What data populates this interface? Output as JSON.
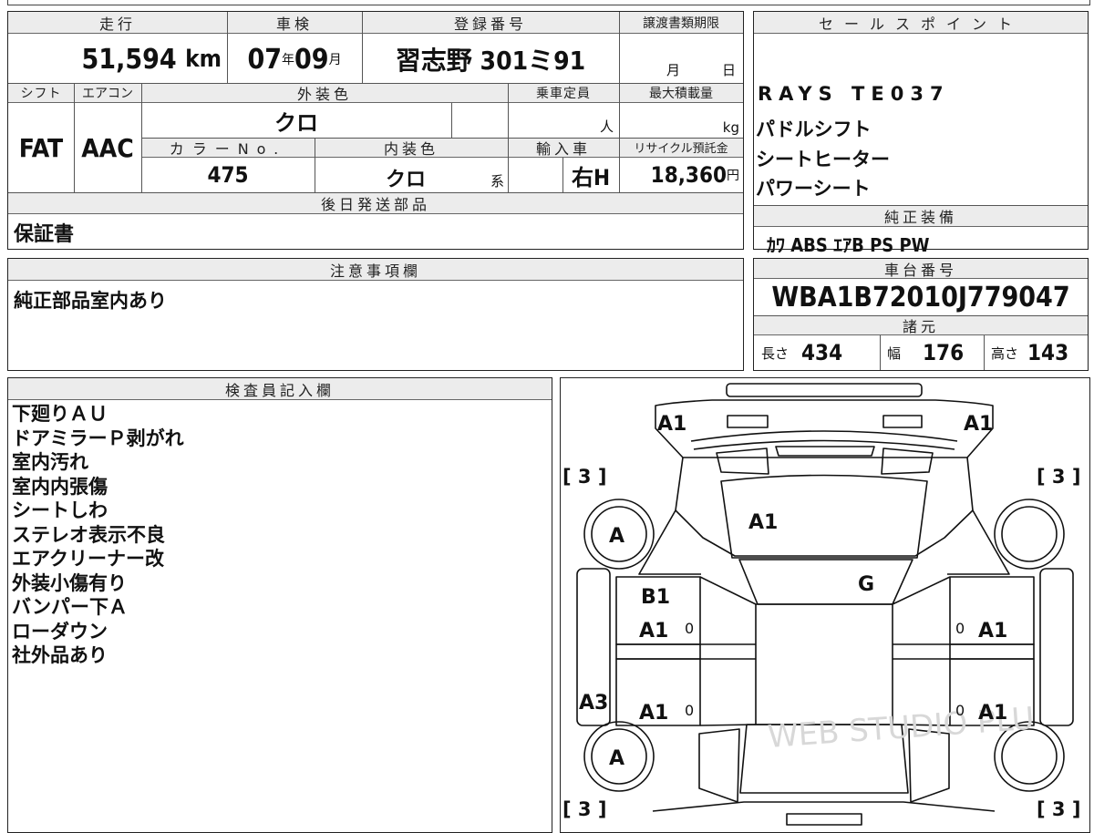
{
  "main": {
    "headers": {
      "mileage": "走行",
      "inspection": "車検",
      "registration": "登録番号",
      "transfer_deadline": "譲渡書類期限",
      "shift": "シフト",
      "aircon": "エアコン",
      "exterior_color": "外装色",
      "capacity": "乗車定員",
      "max_load": "最大積載量",
      "color_no": "カラーNo.",
      "interior_color": "内装色",
      "import": "輸入車",
      "recycle": "リサイクル預託金",
      "later_parts": "後日発送部品"
    },
    "mileage": "51,594",
    "mileage_unit": "km",
    "inspection_year": "07",
    "year_unit": "年",
    "inspection_month": "09",
    "month_unit": "月",
    "registration": "習志野 301ミ91",
    "transfer_month": "月",
    "transfer_day": "日",
    "shift": "FAT",
    "aircon": "AAC",
    "exterior_color": "クロ",
    "capacity_unit": "人",
    "load_unit": "kg",
    "color_no": "475",
    "interior_color": "クロ",
    "interior_suffix": "系",
    "import_type": "右H",
    "recycle_fee": "18,360",
    "recycle_unit": "円",
    "later_parts": "保証書"
  },
  "sales": {
    "header": "セールスポイント",
    "items": [
      "RAYS TE037",
      "パドルシフト",
      "シートヒーター",
      "パワーシート"
    ]
  },
  "equipment": {
    "header": "純正装備",
    "value": "ｶﾜ ABS ｴｱB PS PW"
  },
  "notes": {
    "header": "注意事項欄",
    "text": "純正部品室内あり"
  },
  "chassis": {
    "header": "車台番号",
    "value": "WBA1B72010J779047"
  },
  "specs": {
    "header": "諸元",
    "length_label": "長さ",
    "length": "434",
    "width_label": "幅",
    "width": "176",
    "height_label": "高さ",
    "height": "143"
  },
  "inspector": {
    "header": "検査員記入欄",
    "lines": [
      "下廻りＡＵ",
      "ドアミラーＰ剥がれ",
      "室内汚れ",
      "室内内張傷",
      "シートしわ",
      "ステレオ表示不良",
      "エアクリーナー改",
      "外装小傷有り",
      "バンパー下Ａ",
      "ローダウン",
      "社外品あり"
    ]
  },
  "diagram": {
    "marks": {
      "front_left": "A1",
      "front_right": "A1",
      "hood": "A1",
      "windshield": "G",
      "wheel_front_left": "A",
      "wheel_rear_left": "A",
      "door_fl_1": "B1",
      "door_fl_2": "A1",
      "door_fl_zero": "0",
      "door_fr": "A1",
      "door_fr_zero": "0",
      "door_rl": "A1",
      "door_rl_zero": "0",
      "door_rr": "A1",
      "door_rr_zero": "0",
      "side_left": "A3",
      "tire_tl": "[ 3 ]",
      "tire_tr": "[ 3 ]",
      "tire_bl": "[ 3 ]",
      "tire_br": "[ 3 ]"
    },
    "watermark": "WEB STUDIO PLU"
  }
}
